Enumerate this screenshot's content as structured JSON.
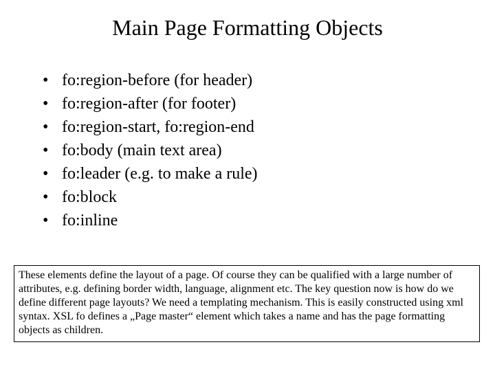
{
  "title": "Main Page Formatting Objects",
  "bullets": [
    "fo:region-before (for header)",
    "fo:region-after (for footer)",
    "fo:region-start, fo:region-end",
    "fo:body (main text area)",
    "fo:leader (e.g. to make a rule)",
    "fo:block",
    "fo:inline"
  ],
  "note": "These elements define the layout of a page. Of course they can be qualified with a large number of attributes, e.g. defining border width, language, alignment etc. The key question now is how do we define different page layouts? We need a templating mechanism. This is easily constructed using xml syntax. XSL fo defines a „Page master“ element which takes a name and has the page formatting objects as children."
}
